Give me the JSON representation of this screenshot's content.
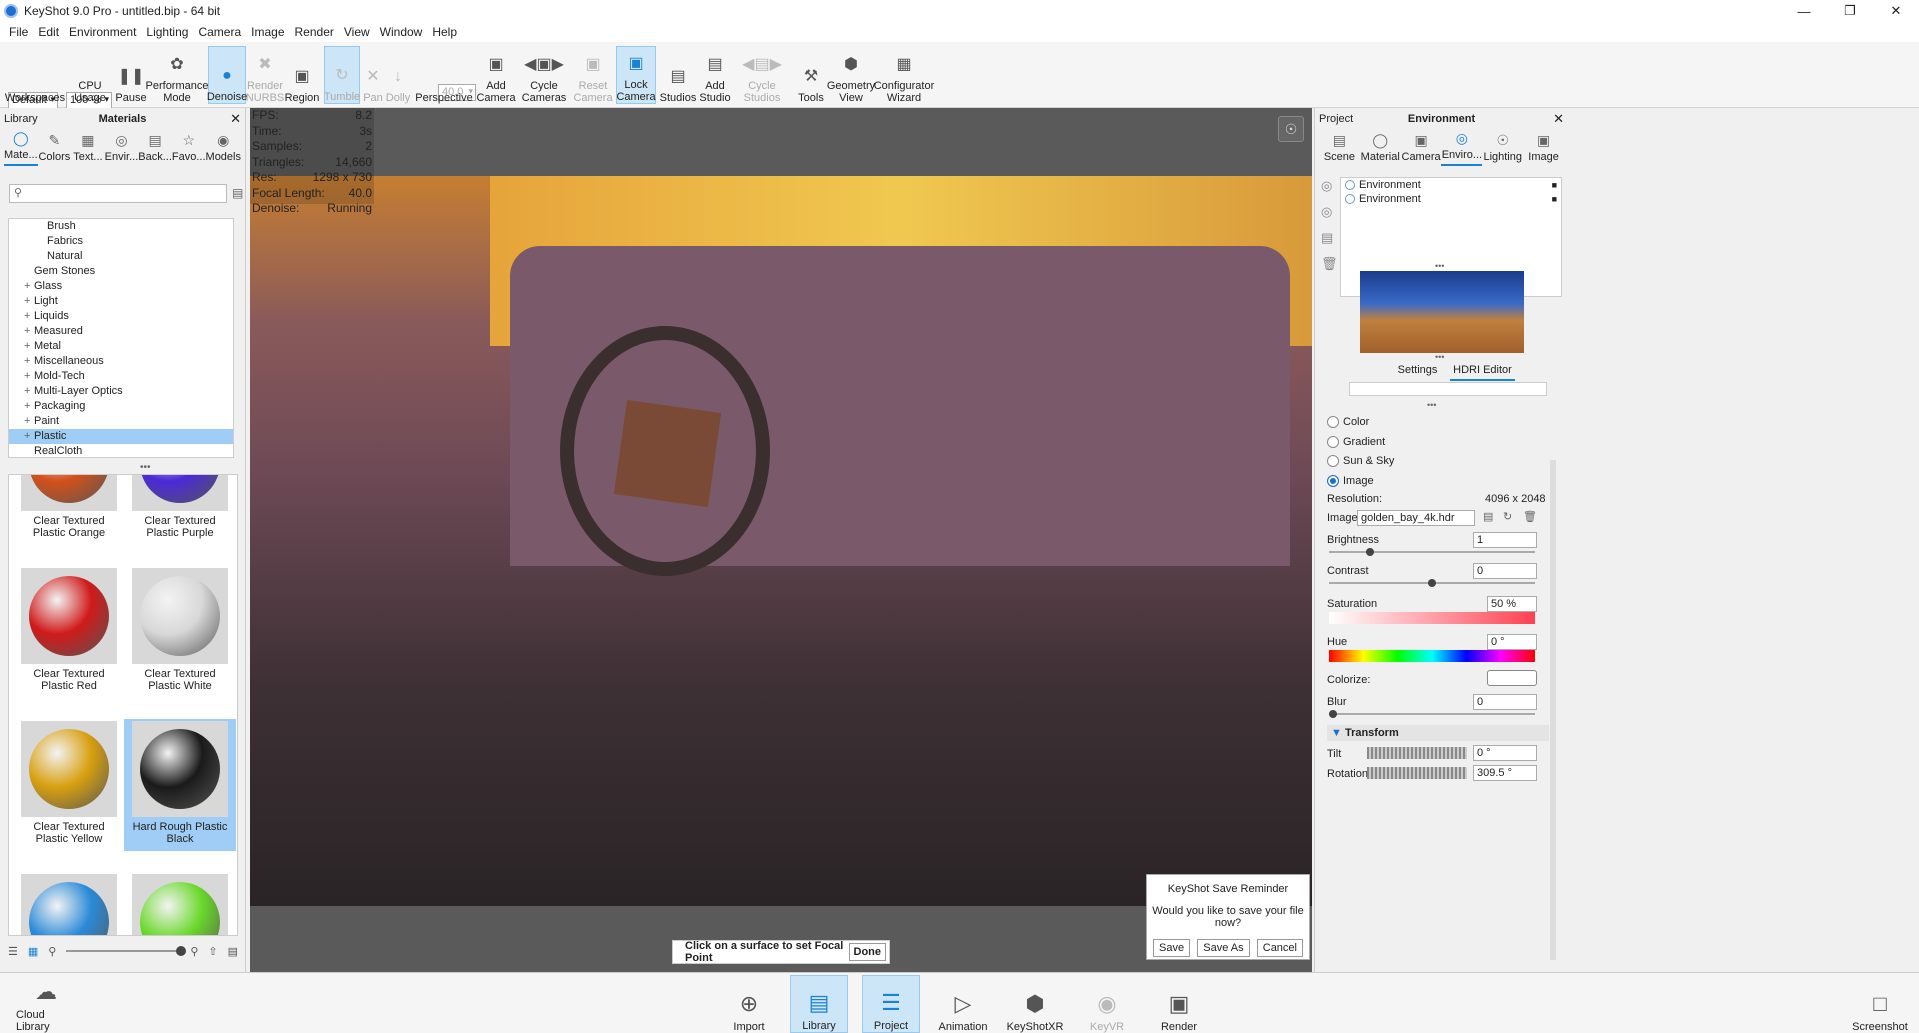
{
  "window": {
    "title": "KeyShot 9.0 Pro  - untitled.bip  - 64 bit"
  },
  "menu": [
    "File",
    "Edit",
    "Environment",
    "Lighting",
    "Camera",
    "Image",
    "Render",
    "View",
    "Window",
    "Help"
  ],
  "toolbar": {
    "workspace_value": "Default",
    "cpu_value": "100 %",
    "perspective_value": "40.0",
    "items": [
      "Workspaces",
      "CPU Usage",
      "Pause",
      "Performance Mode",
      "Denoise",
      "Render NURBS",
      "Region",
      "Tumble",
      "Pan",
      "Dolly",
      "Perspective",
      "Add Camera",
      "Cycle Cameras",
      "Reset Camera",
      "Lock Camera",
      "Studios",
      "Add Studio",
      "Cycle Studios",
      "Tools",
      "Geometry View",
      "Configurator Wizard"
    ]
  },
  "library": {
    "left_title": "Library",
    "center_title": "Materials",
    "tabs": [
      "Mate...",
      "Colors",
      "Text...",
      "Envir...",
      "Back...",
      "Favo...",
      "Models"
    ],
    "search_placeholder": "",
    "tree": [
      {
        "label": "Brush",
        "prefix": "",
        "indent": 2
      },
      {
        "label": "Fabrics",
        "prefix": "",
        "indent": 2
      },
      {
        "label": "Natural",
        "prefix": "",
        "indent": 2
      },
      {
        "label": "Gem Stones",
        "prefix": "",
        "indent": 1
      },
      {
        "label": "Glass",
        "prefix": "+",
        "indent": 1
      },
      {
        "label": "Light",
        "prefix": "+",
        "indent": 1
      },
      {
        "label": "Liquids",
        "prefix": "+",
        "indent": 1
      },
      {
        "label": "Measured",
        "prefix": "+",
        "indent": 1
      },
      {
        "label": "Metal",
        "prefix": "+",
        "indent": 1
      },
      {
        "label": "Miscellaneous",
        "prefix": "+",
        "indent": 1
      },
      {
        "label": "Mold-Tech",
        "prefix": "+",
        "indent": 1
      },
      {
        "label": "Multi-Layer Optics",
        "prefix": "+",
        "indent": 1
      },
      {
        "label": "Packaging",
        "prefix": "+",
        "indent": 1
      },
      {
        "label": "Paint",
        "prefix": "+",
        "indent": 1
      },
      {
        "label": "Plastic",
        "prefix": "+",
        "indent": 1
      },
      {
        "label": "RealCloth",
        "prefix": "",
        "indent": 1
      }
    ],
    "thumbs": [
      {
        "label": "Clear Textured Plastic Orange",
        "color": "#d4501a"
      },
      {
        "label": "Clear Textured Plastic Purple",
        "color": "#4a2ad8"
      },
      {
        "label": "Clear Textured Plastic Red",
        "color": "#d01a1a"
      },
      {
        "label": "Clear Textured Plastic White",
        "color": "#d8d8d8"
      },
      {
        "label": "Clear Textured Plastic Yellow",
        "color": "#d8a010"
      },
      {
        "label": "Hard Rough Plastic Black",
        "color": "#1a1a1a"
      },
      {
        "label": "",
        "color": "#2a8ad8"
      },
      {
        "label": "",
        "color": "#6ad82a"
      }
    ],
    "cloud_label": "Cloud Library"
  },
  "stats": [
    {
      "k": "FPS:",
      "v": "8.2"
    },
    {
      "k": "Time:",
      "v": "3s"
    },
    {
      "k": "Samples:",
      "v": "2"
    },
    {
      "k": "Triangles:",
      "v": "14,660"
    },
    {
      "k": "Res:",
      "v": "1298 x 730"
    },
    {
      "k": "Focal Length:",
      "v": "40.0"
    },
    {
      "k": "Denoise:",
      "v": "Running"
    }
  ],
  "focal_prompt": {
    "text": "Click on a surface to set Focal Point",
    "done": "Done"
  },
  "reminder": {
    "title": "KeyShot Save Reminder",
    "question": "Would you like to save your file now?",
    "save": "Save",
    "save_as": "Save As",
    "cancel": "Cancel"
  },
  "project": {
    "left_title": "Project",
    "center_title": "Environment",
    "tabs": [
      "Scene",
      "Material",
      "Camera",
      "Enviro...",
      "Lighting",
      "Image"
    ],
    "env_items": [
      "Environment",
      "Environment"
    ],
    "subtabs": [
      "Settings",
      "HDRI Editor"
    ],
    "radios": [
      "Color",
      "Gradient",
      "Sun & Sky",
      "Image"
    ],
    "resolution_label": "Resolution:",
    "resolution_value": "4096 x 2048",
    "image_label": "Image",
    "image_value": "golden_bay_4k.hdr",
    "brightness_label": "Brightness",
    "brightness_value": "1",
    "brightness_level": 0.2,
    "contrast_label": "Contrast",
    "contrast_value": "0",
    "contrast_level": 0.5,
    "saturation_label": "Saturation",
    "saturation_value": "50 %",
    "hue_label": "Hue",
    "hue_value": "0 °",
    "colorize_label": "Colorize:",
    "blur_label": "Blur",
    "blur_value": "0",
    "transform_label": "Transform",
    "tilt_label": "Tilt",
    "tilt_value": "0 °",
    "rotation_label": "Rotation",
    "rotation_value": "309.5 °"
  },
  "bottom": {
    "items": [
      "Import",
      "Library",
      "Project",
      "Animation",
      "KeyShotXR",
      "KeyVR",
      "Render"
    ],
    "screenshot": "Screenshot"
  }
}
